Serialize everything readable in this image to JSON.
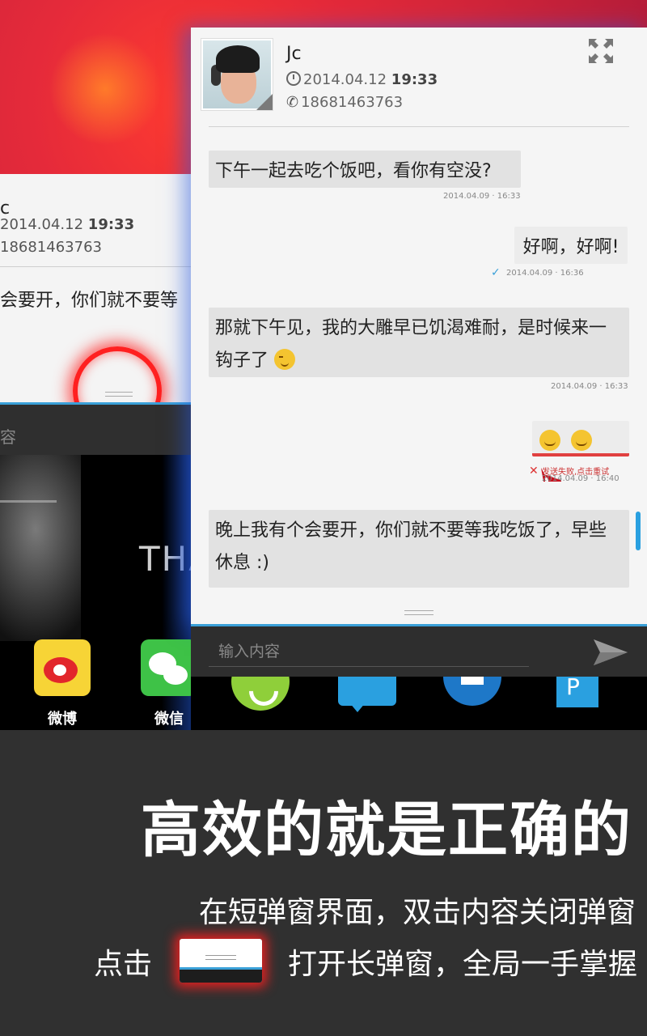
{
  "background_popup": {
    "contact_initial": "c",
    "time_date": "2014.04.12",
    "time_clock": "19:33",
    "phone": "18681463763",
    "message": "会要开，你们就不要等",
    "input_placeholder": "容",
    "wallpaper_text": "THA",
    "apps": [
      {
        "label": "微博",
        "icon": "weibo-icon"
      },
      {
        "label": "微信",
        "icon": "wechat-icon"
      }
    ]
  },
  "popup": {
    "contact_name": "Jc",
    "time_date": "2014.04.12",
    "time_clock": "19:33",
    "phone": "18681463763",
    "messages": [
      {
        "text": "下午一起去吃个饭吧，看你有空没?",
        "timestamp": "2014.04.09 · 16:33",
        "direction": "in"
      },
      {
        "text": "好啊，好啊!",
        "timestamp": "2014.04.09 · 16:36",
        "direction": "out",
        "status": "sent"
      },
      {
        "text": "那就下午见，我的大雕早已饥渴难耐，是时候来一钩子了",
        "timestamp": "2014.04.09 · 16:33",
        "direction": "in"
      },
      {
        "text": "",
        "timestamp": "2014.04.09 · 16:40",
        "direction": "out",
        "status_text": "发送失败,点击重试"
      },
      {
        "text": "晚上我有个会要开，你们就不要等我吃饭了，早些休息 :)",
        "direction": "in"
      }
    ],
    "input_placeholder": "输入内容",
    "colors": {
      "accent": "#3aa0d8",
      "error": "#e04040"
    }
  },
  "caption": {
    "headline": "高效的就是正确的",
    "line1": "在短弹窗界面，双击内容关闭弹窗",
    "line2_prefix": "点击",
    "line2_suffix": "打开长弹窗，全局一手掌握"
  }
}
